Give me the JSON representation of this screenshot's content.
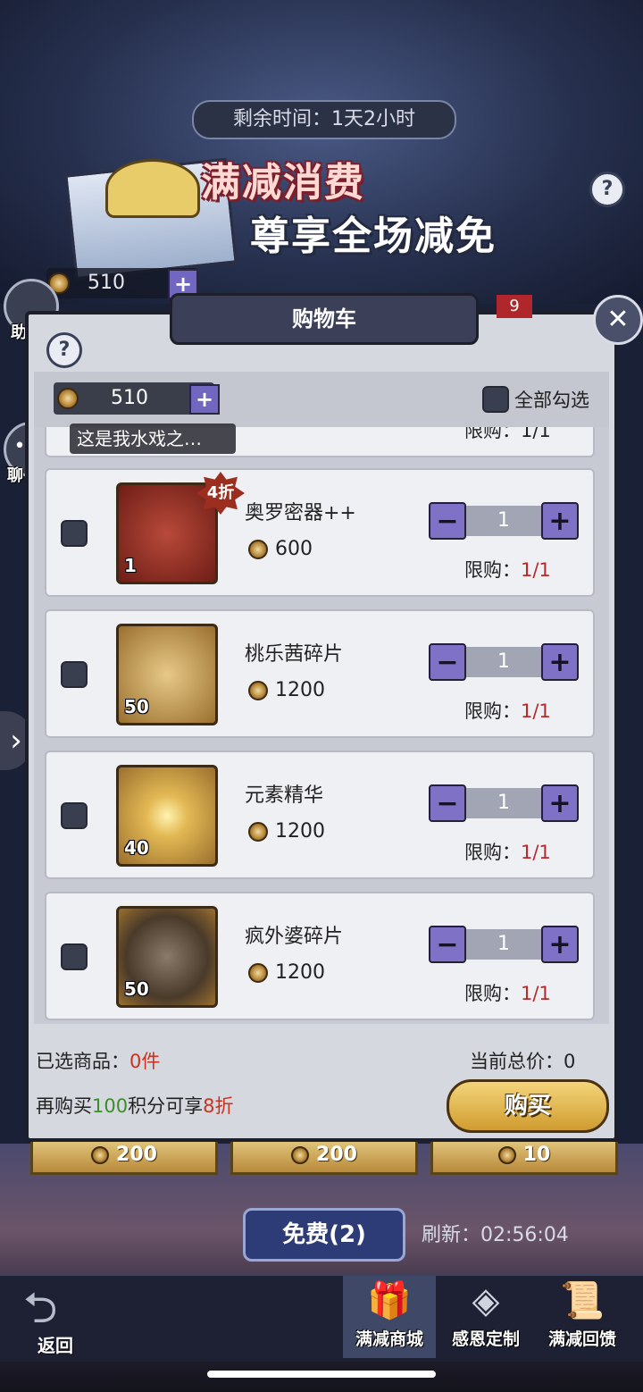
{
  "banner": {
    "timer": "剩余时间：1天2小时",
    "title_line1": "满减消费",
    "title_line2": "尊享全场减免",
    "currency_amount": "510"
  },
  "sidebar": {
    "assistant_label": "助手",
    "chat_label": "聊 天",
    "chat_message": "这是我水戏之…"
  },
  "cart": {
    "title": "购物车",
    "badge": "9",
    "currency_amount": "510",
    "select_all_label": "全部勾选",
    "partial_limit_text": "限购：1/1",
    "items": [
      {
        "name": "奥罗密器++",
        "price": "600",
        "count": "1",
        "discount": "4折",
        "qty": "1",
        "limit_label": "限购：",
        "limit_value": "1/1",
        "image_bg": "#8a2a22"
      },
      {
        "name": "桃乐茜碎片",
        "price": "1200",
        "count": "50",
        "qty": "1",
        "limit_label": "限购：",
        "limit_value": "1/1",
        "image_bg": "#c89a4e"
      },
      {
        "name": "元素精华",
        "price": "1200",
        "count": "40",
        "qty": "1",
        "limit_label": "限购：",
        "limit_value": "1/1",
        "image_bg": "#c89a4e"
      },
      {
        "name": "疯外婆碎片",
        "price": "1200",
        "count": "50",
        "qty": "1",
        "limit_label": "限购：",
        "limit_value": "1/1",
        "image_bg": "#c89a4e"
      }
    ],
    "selected_label": "已选商品：",
    "selected_value": "0件",
    "total_label": "当前总价：",
    "total_value": "0",
    "promo_prefix": "再购买",
    "promo_points": "100",
    "promo_middle": "积分可享",
    "promo_discount": "8折",
    "buy_label": "购买"
  },
  "behind_cards": [
    "200",
    "200",
    "10"
  ],
  "free_button": "免费(2)",
  "refresh": "刷新：02:56:04",
  "nav": {
    "back": "返回",
    "tabs": [
      {
        "label": "满减商城",
        "icon": "gift-icon",
        "active": true
      },
      {
        "label": "感恩定制",
        "icon": "treasure-icon",
        "active": false
      },
      {
        "label": "满减回馈",
        "icon": "scroll-icon",
        "active": false
      }
    ]
  }
}
